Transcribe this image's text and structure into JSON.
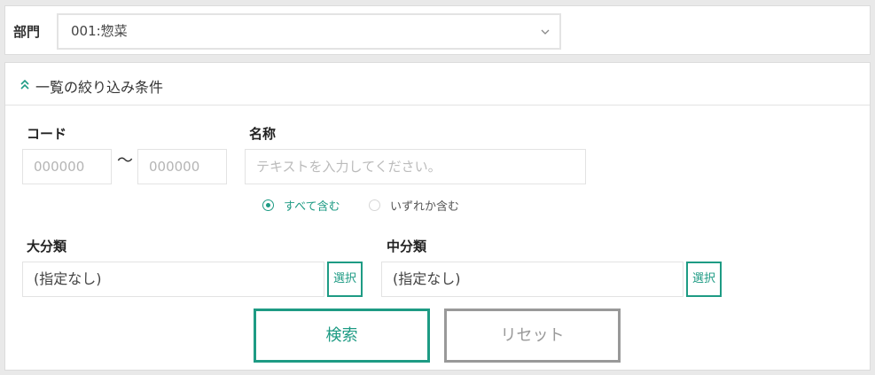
{
  "department": {
    "label": "部門",
    "selected": "001:惣菜"
  },
  "filter": {
    "title": "一覧の絞り込み条件",
    "code": {
      "label": "コード",
      "from_placeholder": "000000",
      "to_placeholder": "000000",
      "separator": "〜"
    },
    "name": {
      "label": "名称",
      "placeholder": "テキストを入力してください。",
      "match_options": [
        {
          "label": "すべて含む",
          "selected": true
        },
        {
          "label": "いずれか含む",
          "selected": false
        }
      ]
    },
    "major_category": {
      "label": "大分類",
      "value": "(指定なし)",
      "select_label": "選択"
    },
    "middle_category": {
      "label": "中分類",
      "value": "(指定なし)",
      "select_label": "選択"
    },
    "search_label": "検索",
    "reset_label": "リセット"
  },
  "colors": {
    "accent": "#1e9b84",
    "disabled": "#999999"
  }
}
